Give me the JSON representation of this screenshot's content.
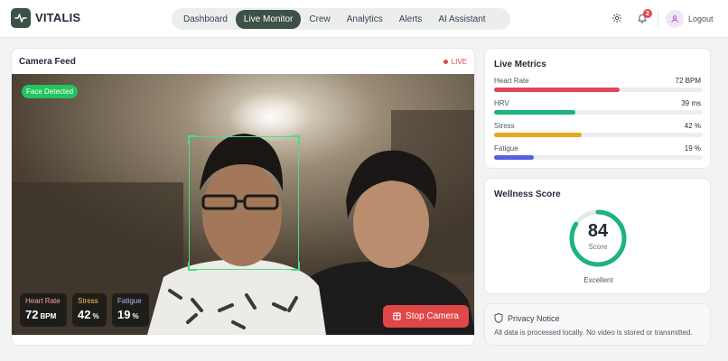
{
  "app": {
    "name": "VITALIS"
  },
  "nav": {
    "items": [
      {
        "label": "Dashboard",
        "active": false
      },
      {
        "label": "Live Monitor",
        "active": true
      },
      {
        "label": "Crew",
        "active": false
      },
      {
        "label": "Analytics",
        "active": false
      },
      {
        "label": "Alerts",
        "active": false
      },
      {
        "label": "AI Assistant",
        "active": false
      }
    ]
  },
  "header": {
    "notification_count": "2",
    "logout_label": "Logout",
    "icons": [
      "gear-icon",
      "bell-icon",
      "user-icon"
    ]
  },
  "camera": {
    "title": "Camera Feed",
    "live_label": "LIVE",
    "face_status": "Face Detected",
    "overlay": {
      "heart_rate": {
        "label": "Heart Rate",
        "value": "72",
        "unit": "BPM",
        "color": "#f4a3a3"
      },
      "stress": {
        "label": "Stress",
        "value": "42",
        "unit": "%",
        "color": "#f5c451"
      },
      "fatigue": {
        "label": "Fatigue",
        "value": "19",
        "unit": "%",
        "color": "#b4b3f5"
      }
    },
    "stop_label": "Stop Camera"
  },
  "live_metrics": {
    "title": "Live Metrics",
    "items": [
      {
        "label": "Heart Rate",
        "value": "72 BPM",
        "level": 0.6,
        "color": "#e0455c"
      },
      {
        "label": "HRV",
        "value": "39 ms",
        "level": 0.39,
        "color": "#1db37d"
      },
      {
        "label": "Stress",
        "value": "42 %",
        "level": 0.42,
        "color": "#e9a71e"
      },
      {
        "label": "Fatigue",
        "value": "19 %",
        "level": 0.19,
        "color": "#5b5ee0"
      }
    ]
  },
  "wellness": {
    "title": "Wellness Score",
    "score": "84",
    "score_fraction": 0.84,
    "score_label": "Score",
    "rating": "Excellent",
    "ring_color": "#1db37d"
  },
  "privacy": {
    "title": "Privacy Notice",
    "text": "All data is processed locally. No video is stored or transmitted."
  },
  "colors": {
    "brand": "#3d5247",
    "danger": "#e04848",
    "detect": "#22c55e"
  }
}
